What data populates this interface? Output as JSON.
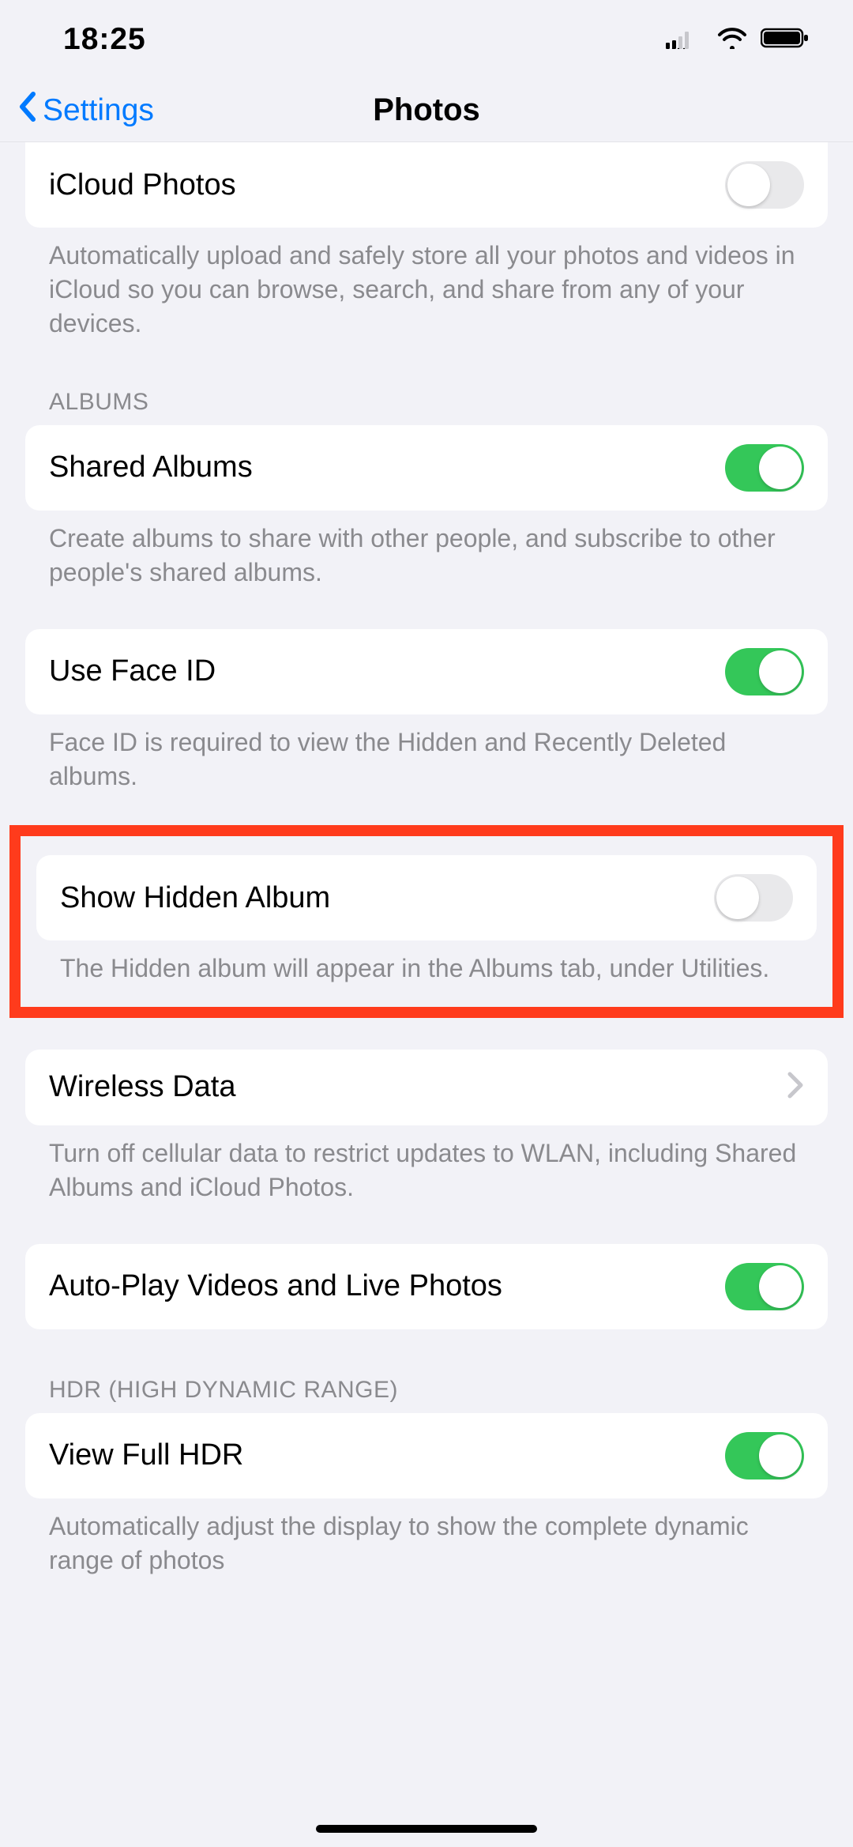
{
  "status": {
    "time": "18:25"
  },
  "nav": {
    "back": "Settings",
    "title": "Photos"
  },
  "photos": {
    "icloud": {
      "label": "iCloud Photos",
      "on": false,
      "footer": "Automatically upload and safely store all your photos and videos in iCloud so you can browse, search, and share from any of your devices."
    },
    "albums_header": "ALBUMS",
    "shared_albums": {
      "label": "Shared Albums",
      "on": true,
      "footer": "Create albums to share with other people, and subscribe to other people's shared albums."
    },
    "face_id": {
      "label": "Use Face ID",
      "on": true,
      "footer": "Face ID is required to view the Hidden and Recently Deleted albums."
    },
    "show_hidden": {
      "label": "Show Hidden Album",
      "on": false,
      "footer": "The Hidden album will appear in the Albums tab, under Utilities."
    },
    "wireless_data": {
      "label": "Wireless Data",
      "footer": "Turn off cellular data to restrict updates to WLAN, including Shared Albums and iCloud Photos."
    },
    "autoplay": {
      "label": "Auto-Play Videos and Live Photos",
      "on": true
    },
    "hdr_header": "HDR (HIGH DYNAMIC RANGE)",
    "view_full_hdr": {
      "label": "View Full HDR",
      "on": true,
      "footer": "Automatically adjust the display to show the complete dynamic range of photos"
    }
  },
  "colors": {
    "accent": "#007aff",
    "toggle_on": "#34c759",
    "highlight": "#ff3b1c"
  }
}
